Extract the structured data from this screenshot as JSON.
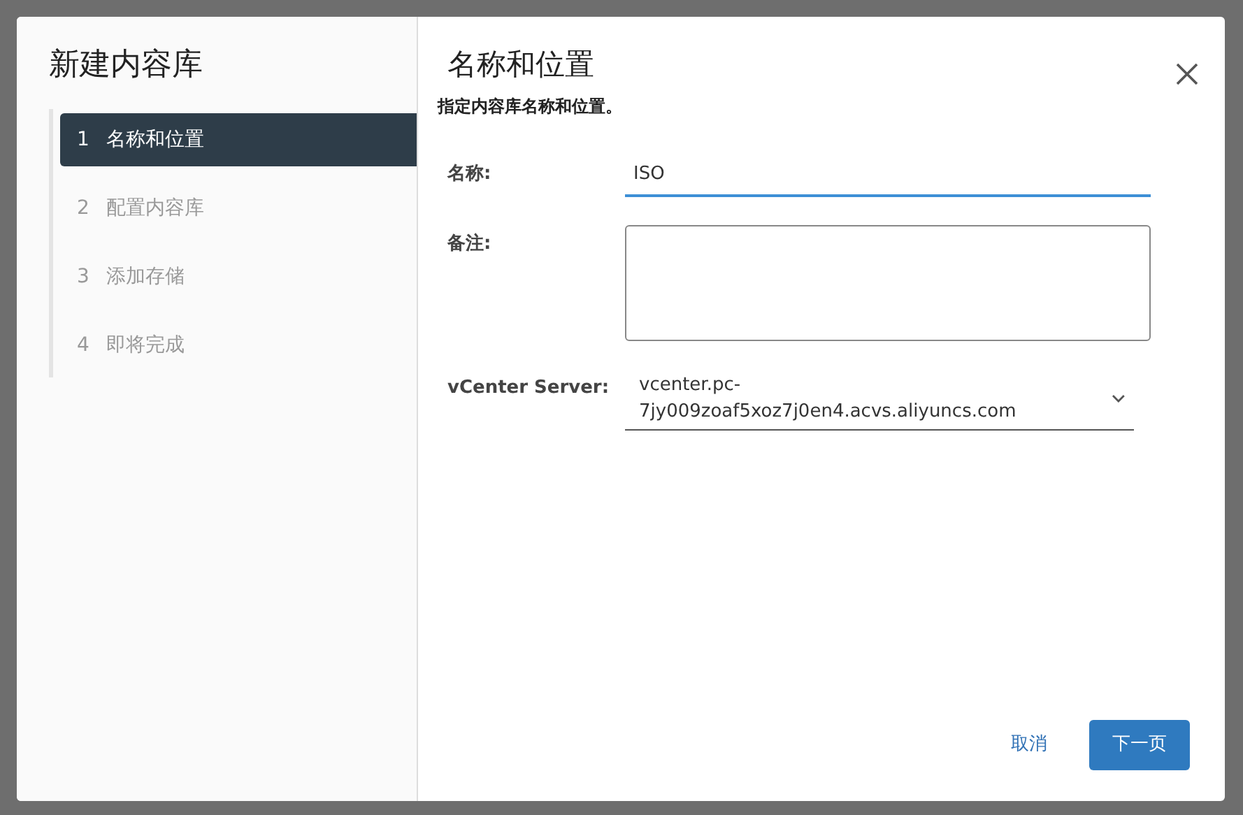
{
  "dialog": {
    "title": "新建内容库",
    "steps": [
      {
        "number": "1",
        "label": "名称和位置",
        "selected": true
      },
      {
        "number": "2",
        "label": "配置内容库",
        "selected": false
      },
      {
        "number": "3",
        "label": "添加存储",
        "selected": false
      },
      {
        "number": "4",
        "label": "即将完成",
        "selected": false
      }
    ],
    "page_title": "名称和位置",
    "subtitle": "指定内容库名称和位置。",
    "fields": [
      {
        "kind": "text",
        "label": "名称:",
        "value": "ISO"
      },
      {
        "kind": "textarea",
        "label": "备注:"
      },
      {
        "kind": "select",
        "label": "vCenter Server:",
        "value": "vcenter.pc-7jy009zoaf5xoz7j0en4.acvs.aliyuncs.com"
      }
    ],
    "buttons": [
      {
        "kind": "link",
        "label": "取消"
      },
      {
        "kind": "primary",
        "label": "下一页"
      }
    ]
  }
}
